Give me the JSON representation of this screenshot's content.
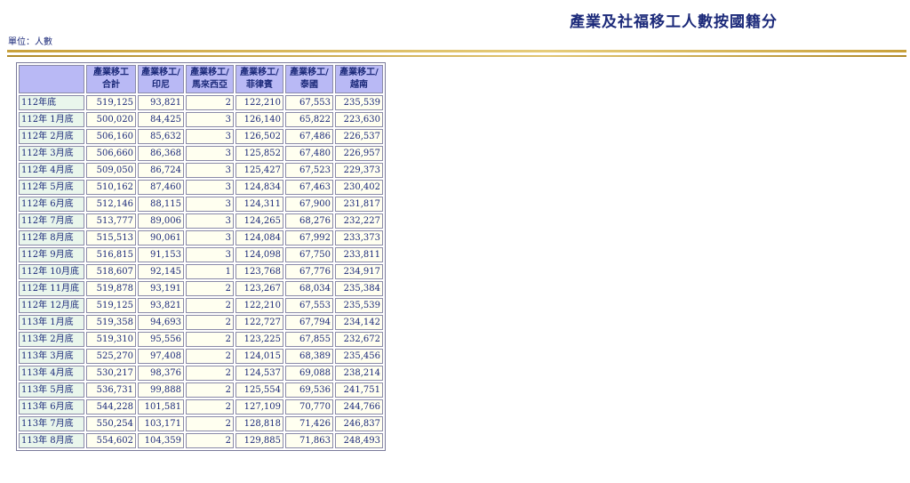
{
  "title": "產業及社福移工人數按國籍分",
  "unit_label": "單位：人數",
  "table": {
    "headers": [
      {
        "line1": "",
        "line2": ""
      },
      {
        "line1": "產業移工",
        "line2": "合計"
      },
      {
        "line1": "產業移工/",
        "line2": "印尼"
      },
      {
        "line1": "產業移工/",
        "line2": "馬來西亞"
      },
      {
        "line1": "產業移工/",
        "line2": "菲律賓"
      },
      {
        "line1": "產業移工/",
        "line2": "泰國"
      },
      {
        "line1": "產業移工/",
        "line2": "越南"
      }
    ],
    "rows": [
      [
        "112年底",
        "519,125",
        "93,821",
        "2",
        "122,210",
        "67,553",
        "235,539"
      ],
      [
        "112年 1月底",
        "500,020",
        "84,425",
        "3",
        "126,140",
        "65,822",
        "223,630"
      ],
      [
        "112年 2月底",
        "506,160",
        "85,632",
        "3",
        "126,502",
        "67,486",
        "226,537"
      ],
      [
        "112年 3月底",
        "506,660",
        "86,368",
        "3",
        "125,852",
        "67,480",
        "226,957"
      ],
      [
        "112年 4月底",
        "509,050",
        "86,724",
        "3",
        "125,427",
        "67,523",
        "229,373"
      ],
      [
        "112年 5月底",
        "510,162",
        "87,460",
        "3",
        "124,834",
        "67,463",
        "230,402"
      ],
      [
        "112年 6月底",
        "512,146",
        "88,115",
        "3",
        "124,311",
        "67,900",
        "231,817"
      ],
      [
        "112年 7月底",
        "513,777",
        "89,006",
        "3",
        "124,265",
        "68,276",
        "232,227"
      ],
      [
        "112年 8月底",
        "515,513",
        "90,061",
        "3",
        "124,084",
        "67,992",
        "233,373"
      ],
      [
        "112年 9月底",
        "516,815",
        "91,153",
        "3",
        "124,098",
        "67,750",
        "233,811"
      ],
      [
        "112年 10月底",
        "518,607",
        "92,145",
        "1",
        "123,768",
        "67,776",
        "234,917"
      ],
      [
        "112年 11月底",
        "519,878",
        "93,191",
        "2",
        "123,267",
        "68,034",
        "235,384"
      ],
      [
        "112年 12月底",
        "519,125",
        "93,821",
        "2",
        "122,210",
        "67,553",
        "235,539"
      ],
      [
        "113年 1月底",
        "519,358",
        "94,693",
        "2",
        "122,727",
        "67,794",
        "234,142"
      ],
      [
        "113年 2月底",
        "519,310",
        "95,556",
        "2",
        "123,225",
        "67,855",
        "232,672"
      ],
      [
        "113年 3月底",
        "525,270",
        "97,408",
        "2",
        "124,015",
        "68,389",
        "235,456"
      ],
      [
        "113年 4月底",
        "530,217",
        "98,376",
        "2",
        "124,537",
        "69,088",
        "238,214"
      ],
      [
        "113年 5月底",
        "536,731",
        "99,888",
        "2",
        "125,554",
        "69,536",
        "241,751"
      ],
      [
        "113年 6月底",
        "544,228",
        "101,581",
        "2",
        "127,109",
        "70,770",
        "244,766"
      ],
      [
        "113年 7月底",
        "550,254",
        "103,171",
        "2",
        "128,818",
        "71,426",
        "246,837"
      ],
      [
        "113年 8月底",
        "554,602",
        "104,359",
        "2",
        "129,885",
        "71,863",
        "248,493"
      ]
    ]
  }
}
